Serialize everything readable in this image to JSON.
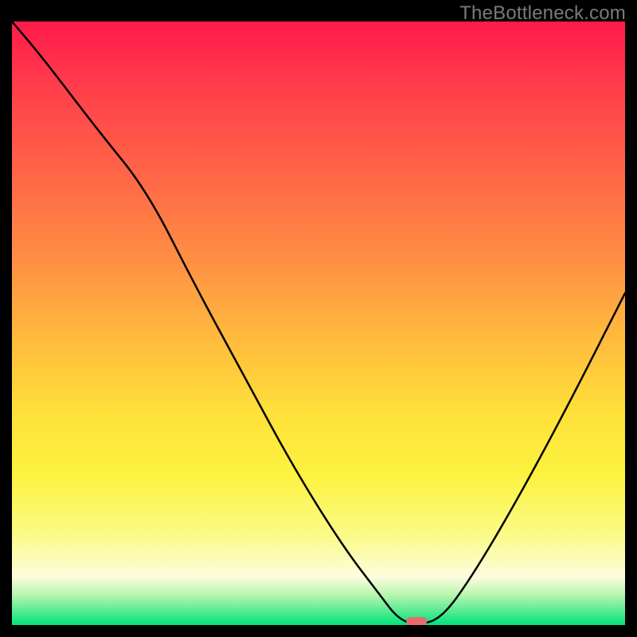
{
  "watermark": "TheBottleneck.com",
  "chart_data": {
    "type": "line",
    "title": "",
    "xlabel": "",
    "ylabel": "",
    "xlim": [
      0,
      100
    ],
    "ylim": [
      0,
      100
    ],
    "grid": false,
    "legend": false,
    "series": [
      {
        "name": "bottleneck-curve",
        "x": [
          0,
          5,
          14,
          22,
          30,
          38,
          46,
          54,
          60,
          63,
          66,
          70,
          75,
          82,
          90,
          100
        ],
        "values": [
          100,
          94,
          82,
          72,
          56,
          41,
          26,
          13,
          5,
          1,
          0,
          1,
          8,
          20,
          35,
          55
        ]
      }
    ],
    "annotations": [
      {
        "type": "marker",
        "shape": "pill",
        "x": 66,
        "y": 0.5,
        "color": "#e86a6f"
      }
    ],
    "background": {
      "type": "gradient",
      "stops": [
        {
          "pos": 0,
          "color": "#ff1a4a"
        },
        {
          "pos": 25,
          "color": "#ff6547"
        },
        {
          "pos": 52,
          "color": "#ffb93e"
        },
        {
          "pos": 75,
          "color": "#fcf23f"
        },
        {
          "pos": 92,
          "color": "#fdfddf"
        },
        {
          "pos": 100,
          "color": "#00e27a"
        }
      ]
    }
  }
}
